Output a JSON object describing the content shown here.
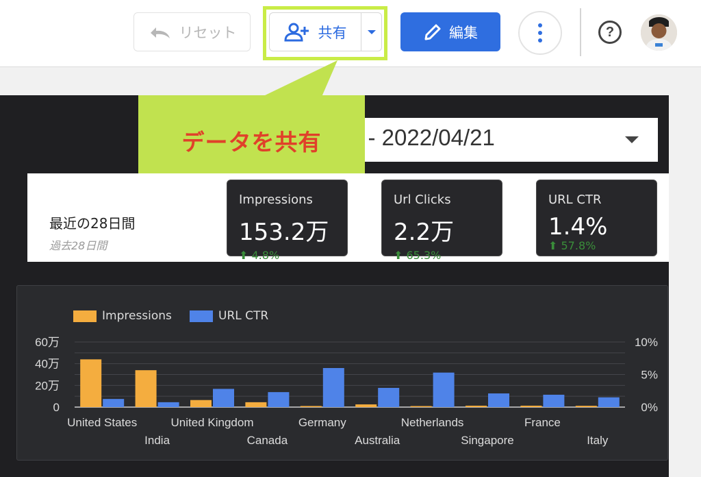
{
  "toolbar": {
    "reset_label": "リセット",
    "share_label": "共有",
    "edit_label": "編集"
  },
  "callout": {
    "text": "データを共有"
  },
  "date_range": {
    "text": "5 - 2022/04/21"
  },
  "period": {
    "label": "最近の28日間",
    "sublabel": "過去28日間"
  },
  "kpis": [
    {
      "title": "Impressions",
      "value": "153.2万",
      "delta": "4.8%"
    },
    {
      "title": "Url Clicks",
      "value": "2.2万",
      "delta": "65.3%"
    },
    {
      "title": "URL CTR",
      "value": "1.4%",
      "delta": "57.8%"
    }
  ],
  "colors": {
    "impressions": "#f4ad3f",
    "ctr": "#4f83e8",
    "accent": "#2f6ee0",
    "highlight": "#c1e24f"
  },
  "chart_data": {
    "type": "bar",
    "categories": [
      "United States",
      "India",
      "United Kingdom",
      "Canada",
      "Germany",
      "Australia",
      "Netherlands",
      "Singapore",
      "France",
      "Italy"
    ],
    "series": [
      {
        "name": "Impressions",
        "axis": "left",
        "values": [
          440000,
          340000,
          65000,
          45000,
          10000,
          25000,
          3000,
          13000,
          13000,
          12000
        ]
      },
      {
        "name": "URL CTR",
        "axis": "right",
        "values": [
          1.25,
          0.75,
          2.8,
          2.3,
          6.0,
          2.95,
          5.3,
          2.1,
          1.9,
          1.5
        ]
      }
    ],
    "y_left": {
      "ticks": [
        "0",
        "20万",
        "40万",
        "60万"
      ],
      "range": [
        0,
        600000
      ]
    },
    "y_right": {
      "ticks": [
        "0%",
        "5%",
        "10%"
      ],
      "range": [
        0,
        10
      ]
    },
    "grid": true,
    "legend": "top-left"
  }
}
